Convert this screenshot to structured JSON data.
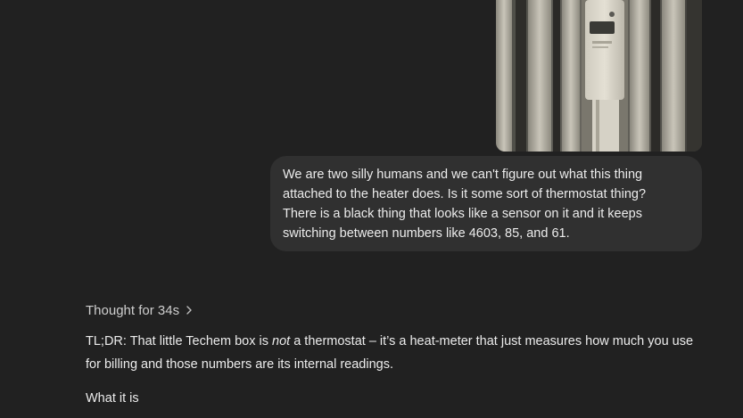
{
  "conversation": {
    "user_message": {
      "lines": [
        "We are two silly humans and we can't figure out what this thing",
        "attached to the heater does. Is it some sort of thermostat thing?",
        "There is a black thing that looks like a sensor on it and it keeps",
        "switching between numbers like 4603, 85, and 61."
      ]
    },
    "assistant_message": {
      "thought_label": "Thought for 34s",
      "tldr": {
        "prefix": "TL;DR: That little Techem box is ",
        "emphasis": "not",
        "suffix": " a thermostat – it’s a heat-meter that just measures how much you use",
        "line2": "for billing and those numbers are its internal readings."
      },
      "section_heading": "What it is"
    }
  },
  "icons": {
    "thought_toggle": "chevron-right-icon"
  },
  "colors": {
    "background": "#212121",
    "bubble": "#303030",
    "text": "#ececec",
    "muted_text": "#cfcfcf"
  }
}
